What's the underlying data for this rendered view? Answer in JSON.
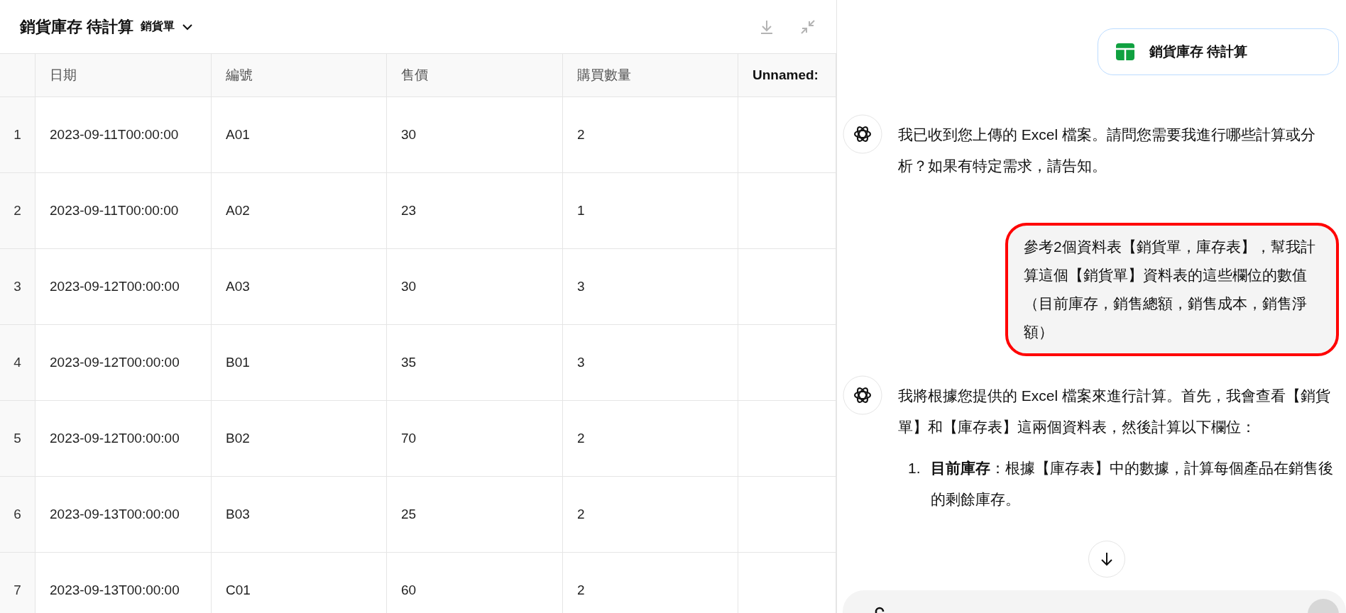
{
  "sheet_panel": {
    "title": "銷貨庫存 待計算",
    "sheet_name": "銷貨單",
    "table": {
      "columns": [
        {
          "label": "日期",
          "bold": false
        },
        {
          "label": "編號",
          "bold": false
        },
        {
          "label": "售價",
          "bold": false
        },
        {
          "label": "購買數量",
          "bold": false
        },
        {
          "label": "Unnamed:",
          "bold": true
        }
      ],
      "rows": [
        {
          "index": "1",
          "cells": [
            "2023-09-11T00:00:00",
            "A01",
            "30",
            "2",
            ""
          ]
        },
        {
          "index": "2",
          "cells": [
            "2023-09-11T00:00:00",
            "A02",
            "23",
            "1",
            ""
          ]
        },
        {
          "index": "3",
          "cells": [
            "2023-09-12T00:00:00",
            "A03",
            "30",
            "3",
            ""
          ]
        },
        {
          "index": "4",
          "cells": [
            "2023-09-12T00:00:00",
            "B01",
            "35",
            "3",
            ""
          ]
        },
        {
          "index": "5",
          "cells": [
            "2023-09-12T00:00:00",
            "B02",
            "70",
            "2",
            ""
          ]
        },
        {
          "index": "6",
          "cells": [
            "2023-09-13T00:00:00",
            "B03",
            "25",
            "2",
            ""
          ]
        },
        {
          "index": "7",
          "cells": [
            "2023-09-13T00:00:00",
            "C01",
            "60",
            "2",
            ""
          ]
        }
      ]
    }
  },
  "chat": {
    "file_chip": "銷貨庫存 待計算",
    "messages": [
      {
        "kind": "assistant",
        "text": "我已收到您上傳的 Excel 檔案。請問您需要我進行哪些計算或分析？如果有特定需求，請告知。"
      },
      {
        "kind": "user",
        "highlighted": true,
        "text": "參考2個資料表【銷貨單，庫存表】，幫我計算這個【銷貨單】資料表的這些欄位的數值（目前庫存，銷售總額，銷售成本，銷售淨額）"
      },
      {
        "kind": "assistant",
        "text": "我將根據您提供的 Excel 檔案來進行計算。首先，我會查看【銷貨單】和【庫存表】這兩個資料表，然後計算以下欄位：",
        "list": [
          {
            "number": "1.",
            "text": "**目前庫存**：根據【庫存表】中的數據，計算每個產品在銷售後的剩餘庫存。"
          }
        ]
      }
    ]
  }
}
